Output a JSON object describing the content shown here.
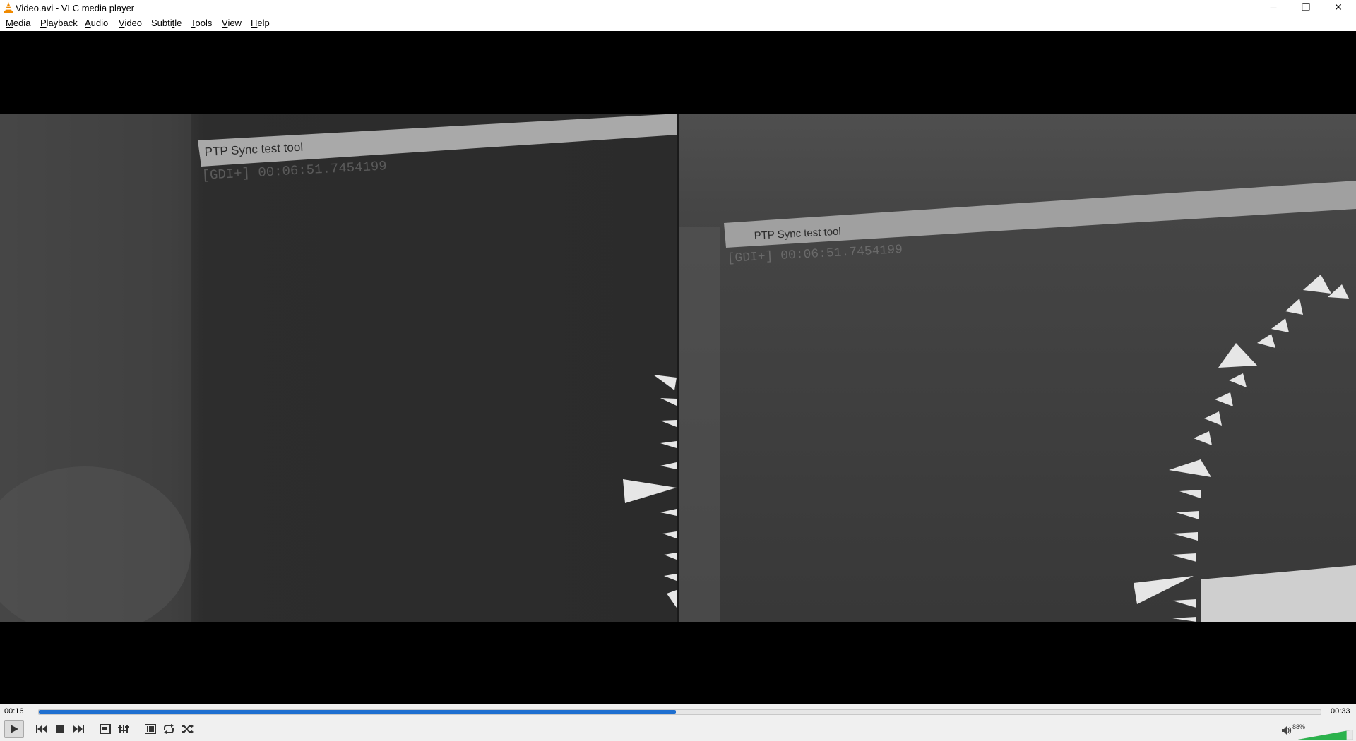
{
  "window": {
    "title": "Video.avi - VLC media player",
    "minimize_glyph": "—",
    "maximize_glyph": "❐",
    "close_glyph": "✕"
  },
  "menu": [
    {
      "pre": "",
      "u": "M",
      "post": "edia"
    },
    {
      "pre": "",
      "u": "P",
      "post": "layback"
    },
    {
      "pre": "",
      "u": "A",
      "post": "udio"
    },
    {
      "pre": "",
      "u": "V",
      "post": "ideo"
    },
    {
      "pre": "Subti",
      "u": "t",
      "post": "le"
    },
    {
      "pre": "",
      "u": "T",
      "post": "ools"
    },
    {
      "pre": "",
      "u": "V",
      "post": "iew"
    },
    {
      "pre": "",
      "u": "H",
      "post": "elp"
    }
  ],
  "video": {
    "left_overlay_title": "PTP Sync test tool",
    "left_overlay_time": "[GDI+] 00:06:51.7454199",
    "right_overlay_title": "PTP Sync test tool",
    "right_overlay_time": "[GDI+] 00:06:51.7454199"
  },
  "playback": {
    "elapsed": "00:16",
    "total": "00:33",
    "progress_fraction": 0.497
  },
  "volume": {
    "percent_label": "88%",
    "level_fraction": 0.88
  },
  "colors": {
    "progress": "#1e6fd0",
    "volume": "#2bb24c",
    "vlc_orange": "#f08a00"
  },
  "icons": {
    "play": "play-icon",
    "previous": "previous-icon",
    "stop": "stop-icon",
    "next": "next-icon",
    "fullscreen": "fullscreen-icon",
    "extended": "extended-settings-icon",
    "playlist": "playlist-icon",
    "loop": "loop-icon",
    "shuffle": "shuffle-icon",
    "mute": "speaker-icon"
  }
}
